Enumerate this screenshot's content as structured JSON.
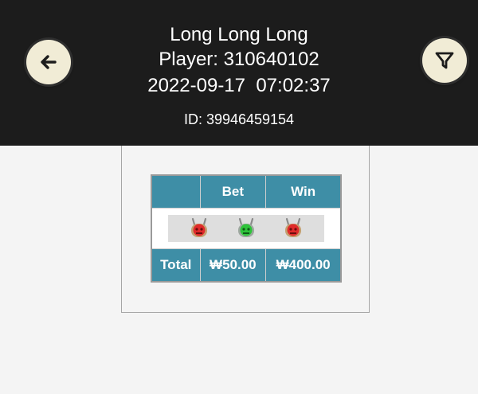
{
  "header": {
    "game_name": "Long Long Long",
    "player": "Player: 310640102",
    "datetime": "2022-09-17  07:02:37",
    "round_id": "ID: 39946459154",
    "back_icon": "arrow-left-icon",
    "filter_icon": "filter-icon",
    "background_color": "#1c1c1c"
  },
  "table": {
    "header_color": "#3e8ea6",
    "columns": [
      "",
      "Bet",
      "Win"
    ],
    "result_icons": [
      {
        "name": "red-robot-icon",
        "color": "#e02a2a"
      },
      {
        "name": "green-robot-icon",
        "color": "#2ec43a"
      },
      {
        "name": "red-robot-icon",
        "color": "#e02a2a"
      }
    ],
    "total_label": "Total",
    "total_bet": "₩50.00",
    "total_win": "₩400.00"
  }
}
